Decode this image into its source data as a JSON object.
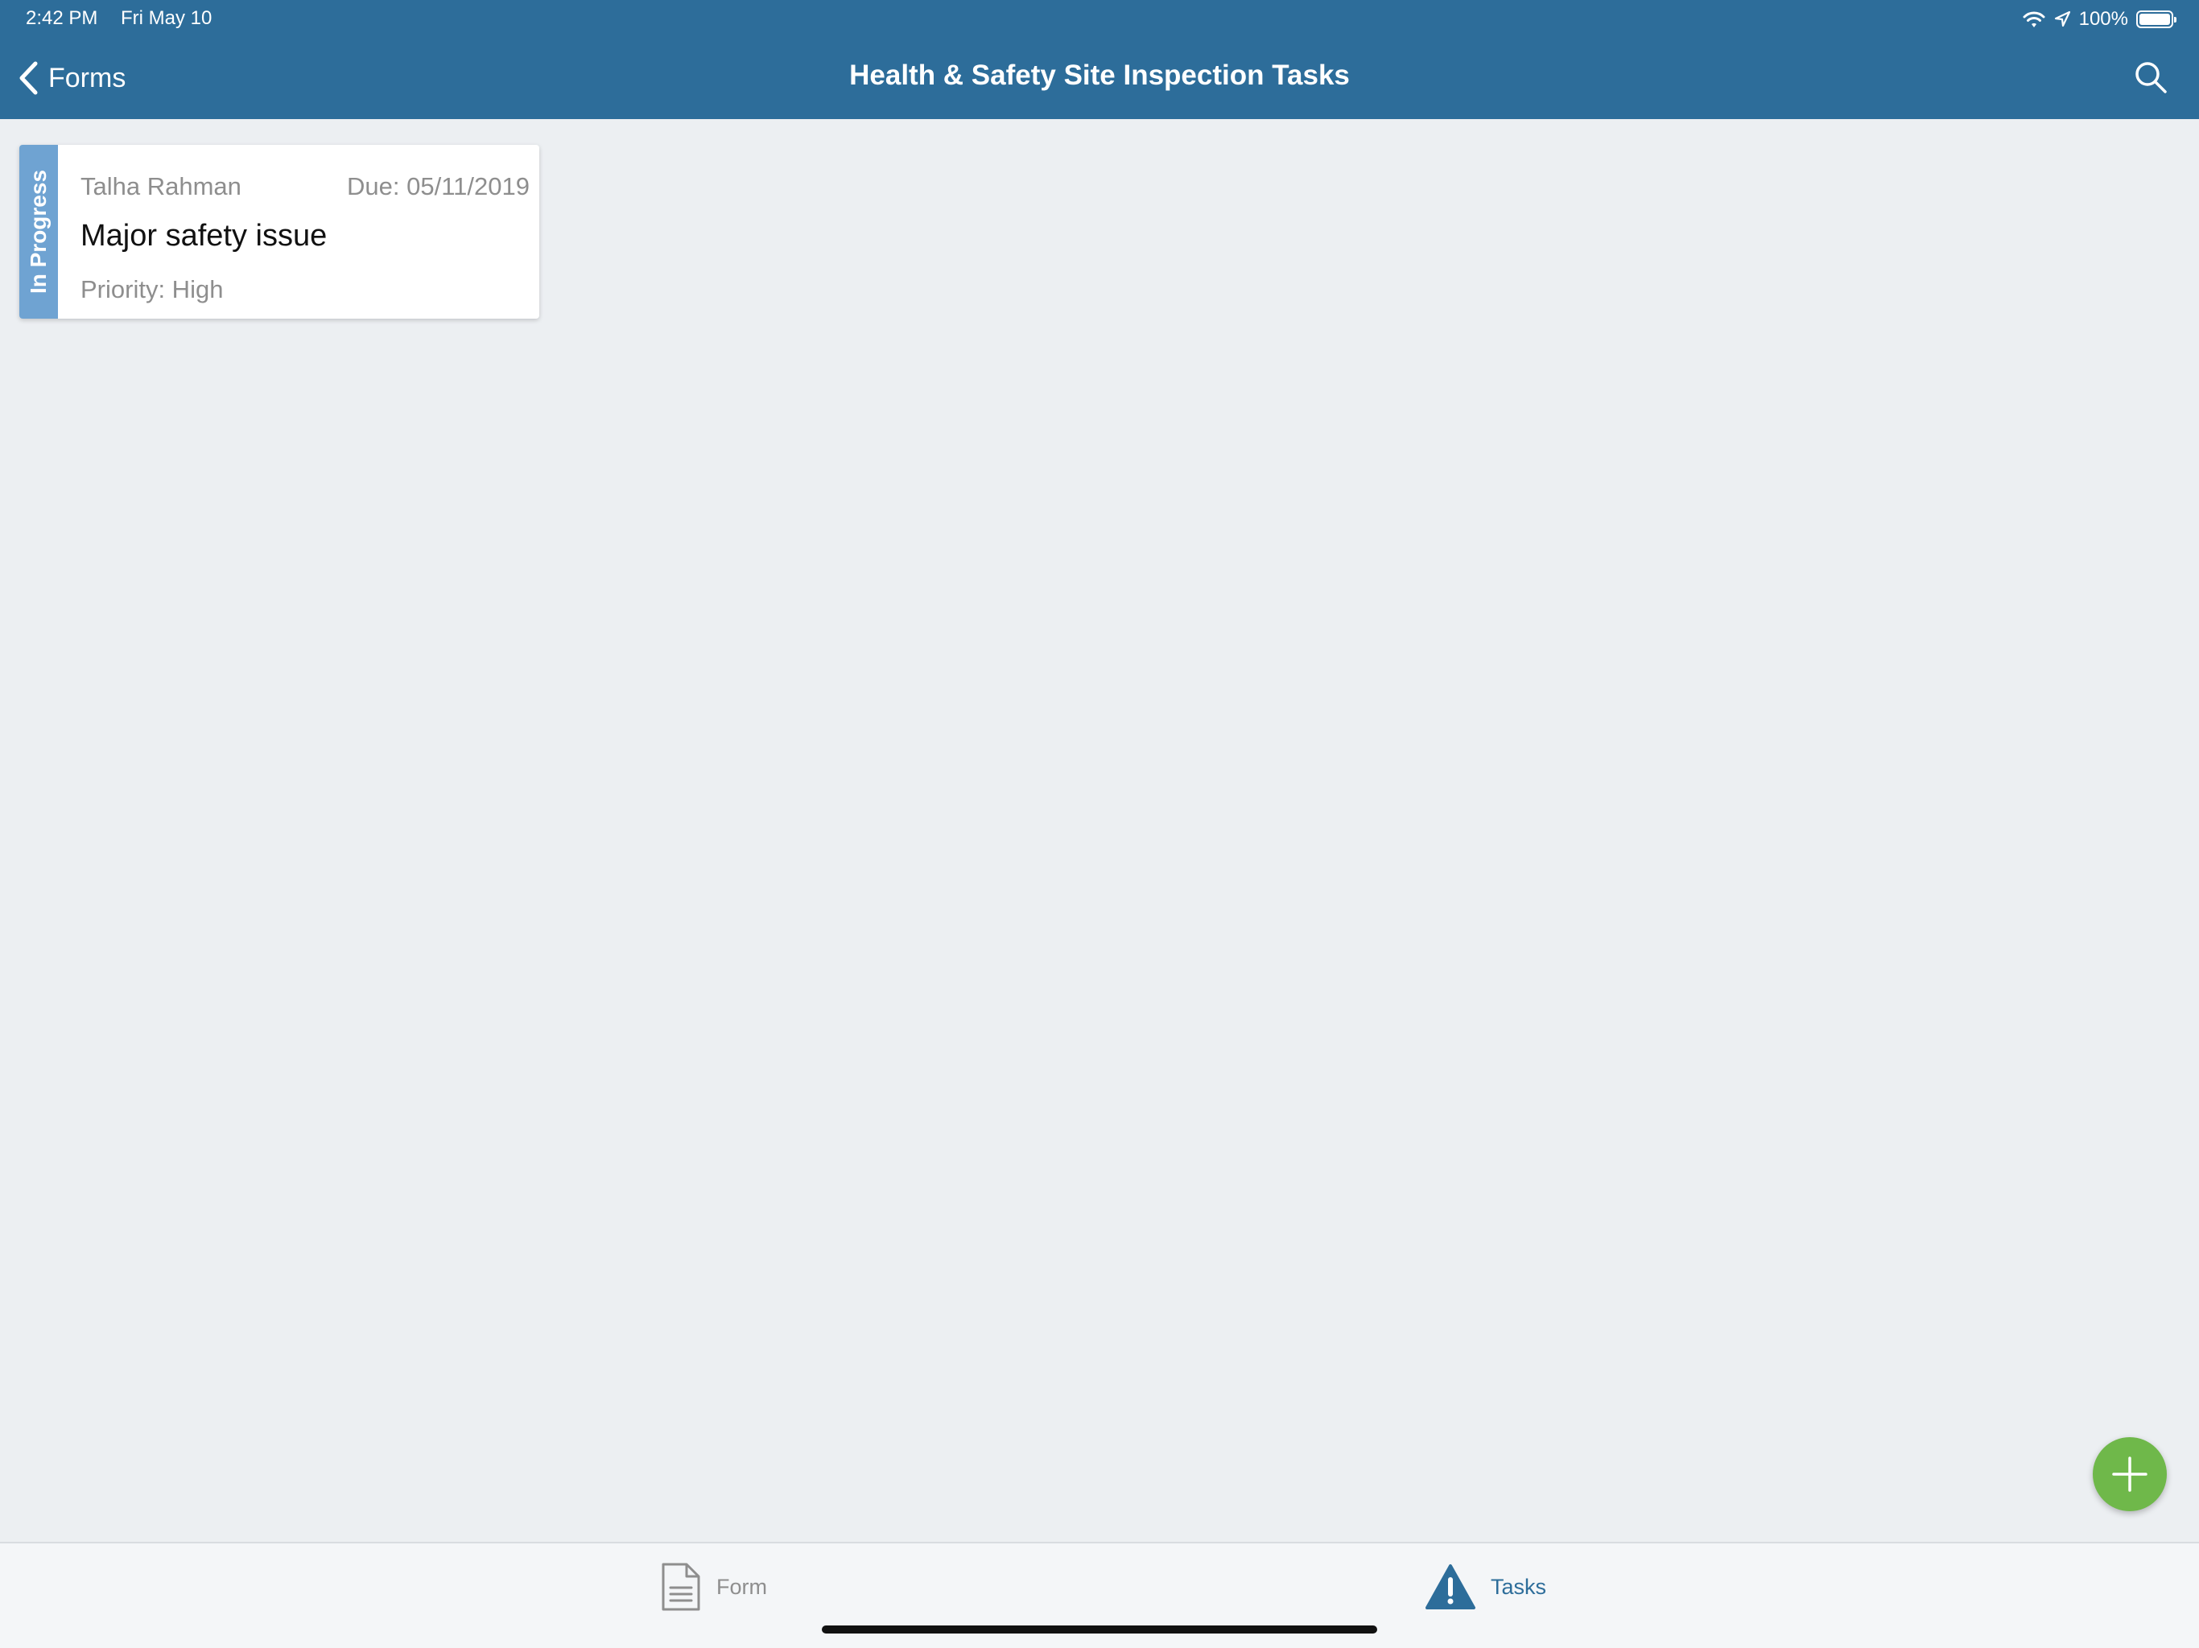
{
  "status_bar": {
    "time": "2:42 PM",
    "date": "Fri May 10",
    "battery": "100%",
    "icons": [
      "wifi-icon",
      "location-arrow-icon",
      "battery-icon"
    ]
  },
  "nav": {
    "back_label": "Forms",
    "title": "Health & Safety Site Inspection Tasks",
    "icons": {
      "back": "chevron-left-icon",
      "search": "search-icon"
    }
  },
  "tasks": [
    {
      "status": "In Progress",
      "assignee": "Talha Rahman",
      "due": "Due: 05/11/2019",
      "title": "Major safety issue",
      "priority": "Priority: High"
    }
  ],
  "fab": {
    "icon": "plus-icon"
  },
  "tab_bar": {
    "tabs": [
      {
        "label": "Form",
        "icon": "document-icon",
        "active": false
      },
      {
        "label": "Tasks",
        "icon": "warning-icon",
        "active": true
      }
    ]
  },
  "colors": {
    "header": "#2D6D9A",
    "background": "#ECEFF2",
    "status_in_progress": "#6FA3D2",
    "fab": "#6FB84A",
    "tab_active": "#2D6D9A",
    "tab_inactive": "#8E8E8E"
  }
}
